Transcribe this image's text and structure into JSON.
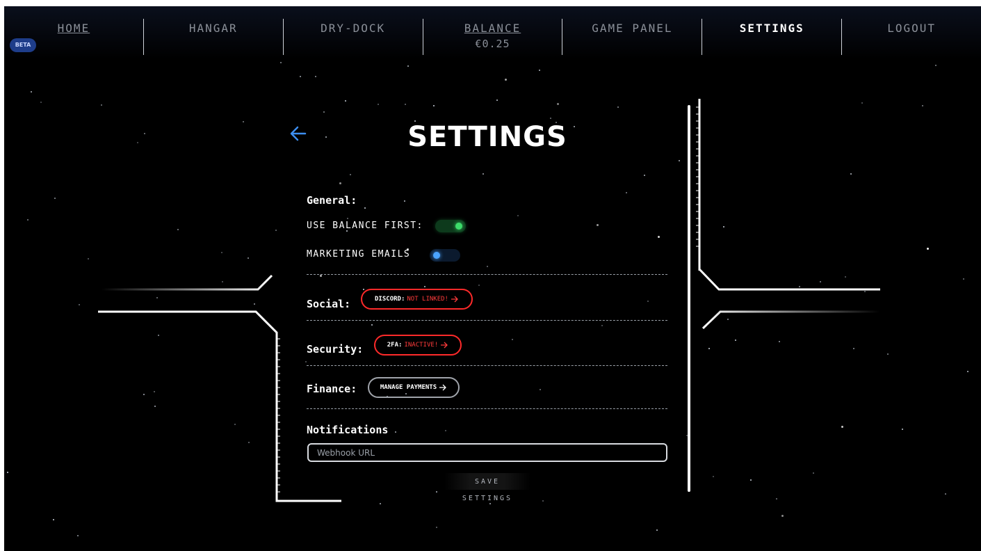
{
  "nav": {
    "items": [
      {
        "label": "HOME",
        "sub": ""
      },
      {
        "label": "HANGAR",
        "sub": ""
      },
      {
        "label": "DRY-DOCK",
        "sub": ""
      },
      {
        "label": "BALANCE",
        "sub": "€0.25"
      },
      {
        "label": "GAME PANEL",
        "sub": ""
      },
      {
        "label": "SETTINGS",
        "sub": ""
      },
      {
        "label": "LOGOUT",
        "sub": ""
      }
    ],
    "beta_badge": "BETA"
  },
  "settings": {
    "title": "SETTINGS",
    "back_icon": "arrow-left-icon",
    "general": {
      "heading": "General:",
      "use_balance_first": {
        "label": "USE BALANCE FIRST:",
        "enabled": true,
        "color": "#3ddc6a"
      },
      "marketing_emails": {
        "label": "MARKETING EMAILS",
        "enabled": false,
        "color": "#4aa3ff"
      }
    },
    "social": {
      "heading": "Social:",
      "discord": {
        "key": "DISCORD:",
        "value": "NOT LINKED!",
        "status_color": "#ff3b3b",
        "icon": "arrow-right-icon"
      }
    },
    "security": {
      "heading": "Security:",
      "twofa": {
        "key": "2FA:",
        "value": "INACTIVE!",
        "status_color": "#ff3b3b",
        "icon": "arrow-right-icon"
      }
    },
    "finance": {
      "heading": "Finance:",
      "manage": {
        "label": "MANAGE PAYMENTS",
        "icon": "arrow-right-icon"
      }
    },
    "notifications": {
      "heading": "Notifications",
      "webhook_placeholder": "Webhook URL",
      "webhook_value": ""
    },
    "save_label": "SAVE SETTINGS"
  },
  "colors": {
    "accent_blue": "#2a8fd0",
    "background": "#000000"
  }
}
